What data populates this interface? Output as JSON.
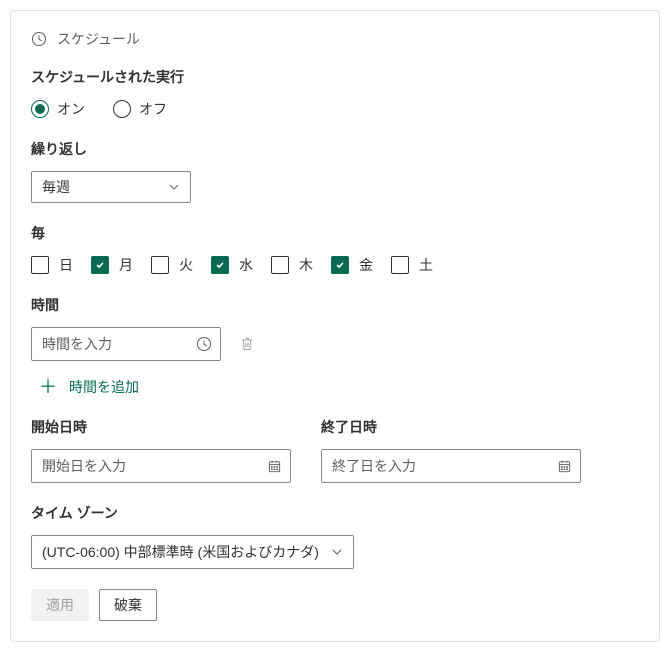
{
  "header": {
    "title": "スケジュール"
  },
  "scheduled_run": {
    "title": "スケジュールされた実行",
    "on_label": "オン",
    "off_label": "オフ",
    "selected": "on"
  },
  "recurrence": {
    "title": "繰り返し",
    "value": "毎週"
  },
  "every": {
    "title": "毎",
    "days": [
      {
        "label": "日",
        "checked": false
      },
      {
        "label": "月",
        "checked": true
      },
      {
        "label": "火",
        "checked": false
      },
      {
        "label": "水",
        "checked": true
      },
      {
        "label": "木",
        "checked": false
      },
      {
        "label": "金",
        "checked": true
      },
      {
        "label": "土",
        "checked": false
      }
    ]
  },
  "time": {
    "title": "時間",
    "placeholder": "時間を入力",
    "add_label": "時間を追加"
  },
  "start_date": {
    "title": "開始日時",
    "placeholder": "開始日を入力"
  },
  "end_date": {
    "title": "終了日時",
    "placeholder": "終了日を入力"
  },
  "timezone": {
    "title": "タイム ゾーン",
    "value": "(UTC-06:00) 中部標準時 (米国およびカナダ)"
  },
  "footer": {
    "apply": "適用",
    "discard": "破棄"
  }
}
